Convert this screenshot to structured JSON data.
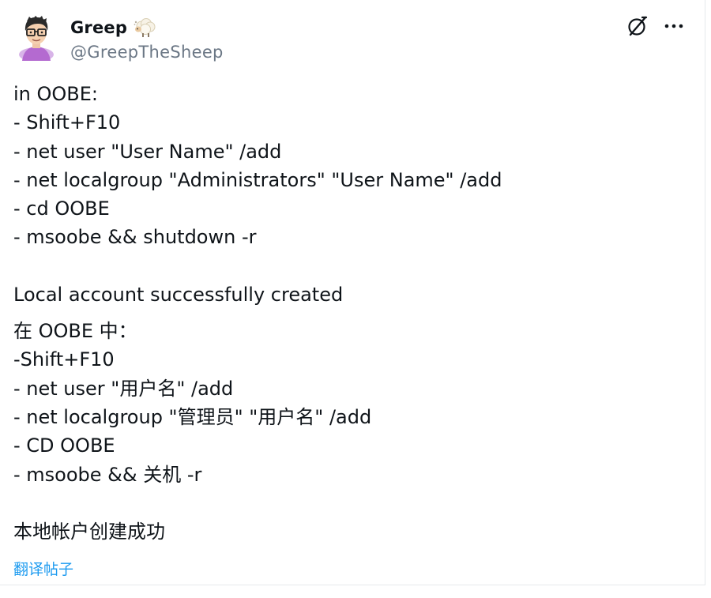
{
  "user": {
    "display_name": "Greep",
    "handle": "@GreepTheSheep",
    "badge_icon": "sheep-icon"
  },
  "actions": {
    "grok_icon": "slash-circle-icon",
    "more_icon": "more-horizontal-icon",
    "more_label": "•••"
  },
  "post": {
    "lines_en": [
      "in OOBE:",
      "- Shift+F10",
      "- net user \"User Name\" /add",
      "- net localgroup \"Administrators\" \"User Name\" /add",
      "- cd OOBE",
      "- msoobe && shutdown -r"
    ],
    "result_en": "Local account successfully created",
    "lines_zh": [
      "在 OOBE 中：",
      "-Shift+F10",
      "- net user \"用户名\" /add",
      "- net localgroup \"管理员\" \"用户名\" /add",
      "- CD OOBE",
      "- msoobe && 关机 -r"
    ],
    "result_zh": "本地帐户创建成功"
  },
  "translate_link": "翻译帖子",
  "colors": {
    "link": "#1d9bf0",
    "text": "#0f1419",
    "secondary": "#6b7785"
  }
}
